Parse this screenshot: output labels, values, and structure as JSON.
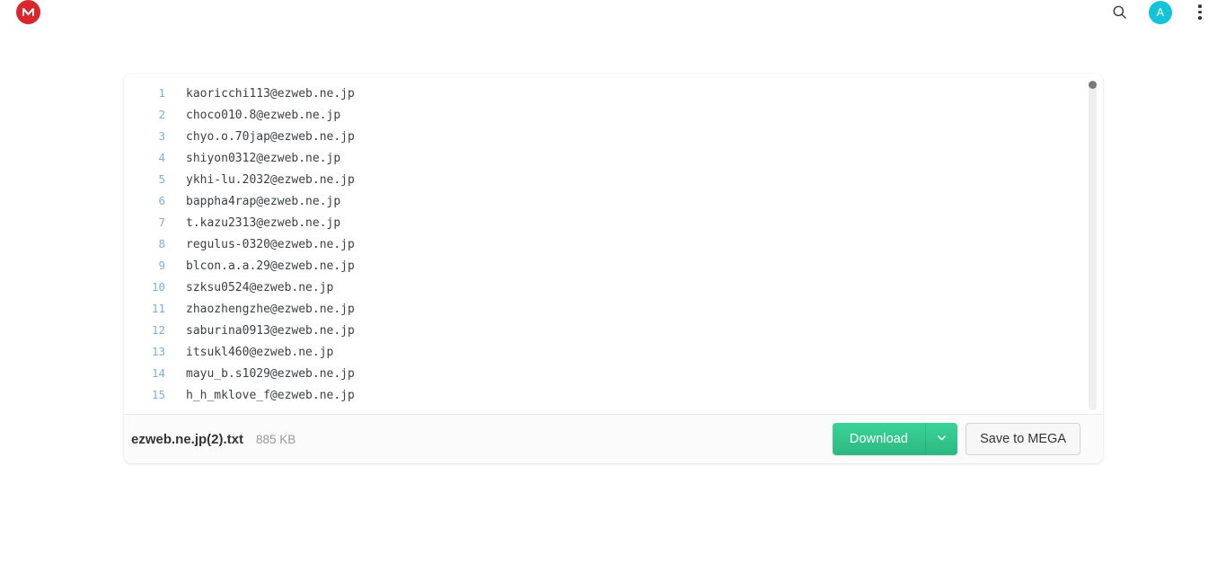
{
  "header": {
    "logo_icon": "mega-logo-icon",
    "logo_letter": "M",
    "search_icon": "search-icon",
    "avatar_initial": "A",
    "avatar_color": "#13c4d8",
    "overflow_icon": "vertical-dots-icon",
    "logo_color": "#d9272e"
  },
  "preview": {
    "code": {
      "lines": [
        {
          "number": "1",
          "text": "kaoricchi113@ezweb.ne.jp"
        },
        {
          "number": "2",
          "text": "choco010.8@ezweb.ne.jp"
        },
        {
          "number": "3",
          "text": "chyo.o.70jap@ezweb.ne.jp"
        },
        {
          "number": "4",
          "text": "shiyon0312@ezweb.ne.jp"
        },
        {
          "number": "5",
          "text": "ykhi-lu.2032@ezweb.ne.jp"
        },
        {
          "number": "6",
          "text": "bappha4rap@ezweb.ne.jp"
        },
        {
          "number": "7",
          "text": "t.kazu2313@ezweb.ne.jp"
        },
        {
          "number": "8",
          "text": "regulus-0320@ezweb.ne.jp"
        },
        {
          "number": "9",
          "text": "blcon.a.a.29@ezweb.ne.jp"
        },
        {
          "number": "10",
          "text": "szksu0524@ezweb.ne.jp"
        },
        {
          "number": "11",
          "text": "zhaozhengzhe@ezweb.ne.jp"
        },
        {
          "number": "12",
          "text": "saburina0913@ezweb.ne.jp"
        },
        {
          "number": "13",
          "text": "itsukl460@ezweb.ne.jp"
        },
        {
          "number": "14",
          "text": "mayu_b.s1029@ezweb.ne.jp"
        },
        {
          "number": "15",
          "text": "h_h_mklove_f@ezweb.ne.jp"
        }
      ],
      "line_number_color": "#7aafe8",
      "text_color": "#3c4043"
    },
    "scrollbar": {
      "name": "code-scrollbar",
      "thumb_position": "top"
    },
    "footer": {
      "file_name": "ezweb.ne.jp(2).txt",
      "file_size": "885 KB",
      "download_label": "Download",
      "download_dropdown_icon": "chevron-down-icon",
      "download_color": "#2cb87f",
      "save_label": "Save to MEGA"
    }
  }
}
